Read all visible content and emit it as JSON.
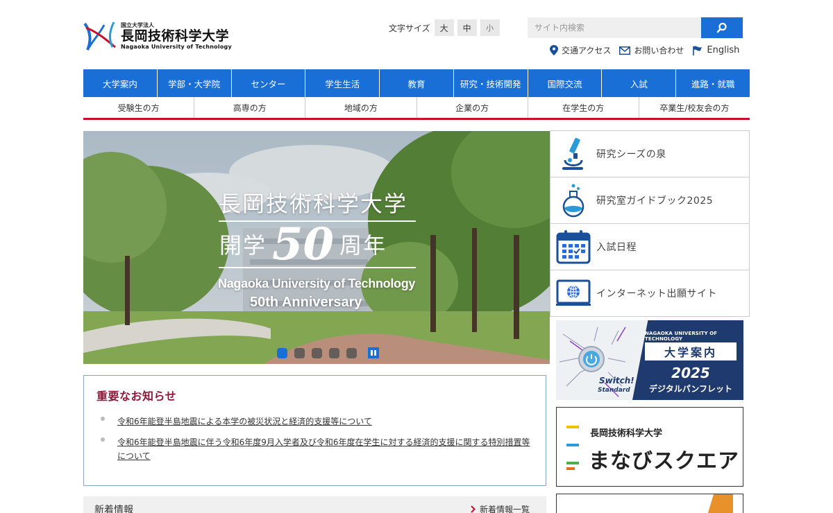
{
  "header": {
    "logo_small": "国立大学法人",
    "logo_name": "長岡技術科学大学",
    "logo_en": "Nagaoka University of Technology",
    "fontsize_label": "文字サイズ",
    "fontsize_options": [
      "大",
      "中",
      "小"
    ],
    "search_placeholder": "サイト内検索",
    "utility_links": [
      "交通アクセス",
      "お問い合わせ",
      "English"
    ]
  },
  "main_nav": [
    "大学案内",
    "学部・大学院",
    "センター",
    "学生生活",
    "教育",
    "研究・技術開発",
    "国際交流",
    "入試",
    "進路・就職"
  ],
  "sub_nav": [
    "受験生の方",
    "高専の方",
    "地域の方",
    "企業の方",
    "在学生の方",
    "卒業生/校友会の方"
  ],
  "hero": {
    "title_jp": "長岡技術科学大学",
    "kaigaku": "開学",
    "number": "50",
    "shunen": "周年",
    "title_en": "Nagaoka University of Technology",
    "anniversary": "50th Anniversary",
    "slide_count": 5,
    "active_slide": 1
  },
  "side_links": [
    {
      "label": "研究シーズの泉",
      "icon": "microscope-icon"
    },
    {
      "label": "研究室ガイドブック2025",
      "icon": "flask-icon"
    },
    {
      "label": "入試日程",
      "icon": "calendar-icon"
    },
    {
      "label": "インターネット出願サイト",
      "icon": "web-icon"
    }
  ],
  "banners": {
    "pamphlet": {
      "small": "NAGAOKA UNIVERSITY OF TECHNOLOGY",
      "box": "大学案内",
      "year": "2025",
      "sub": "デジタルパンフレット",
      "switch": "Switch!",
      "standard": "Standard"
    },
    "manabi": {
      "small": "長岡技術科学大学",
      "big": "まなびスクエア"
    }
  },
  "notice": {
    "title": "重要なお知らせ",
    "items": [
      "令和6年能登半島地震による本学の被災状況と経済的支援等について",
      "令和6年能登半島地震に伴う令和6年度9月入学者及び令和6年度在学生に対する経済的支援に関する特別措置等について"
    ]
  },
  "news": {
    "title": "新着情報",
    "more": "新着情報一覧"
  },
  "colors": {
    "primary": "#1a6fd6",
    "accent_red": "#c8102e",
    "notice_title": "#8b1a3a"
  }
}
